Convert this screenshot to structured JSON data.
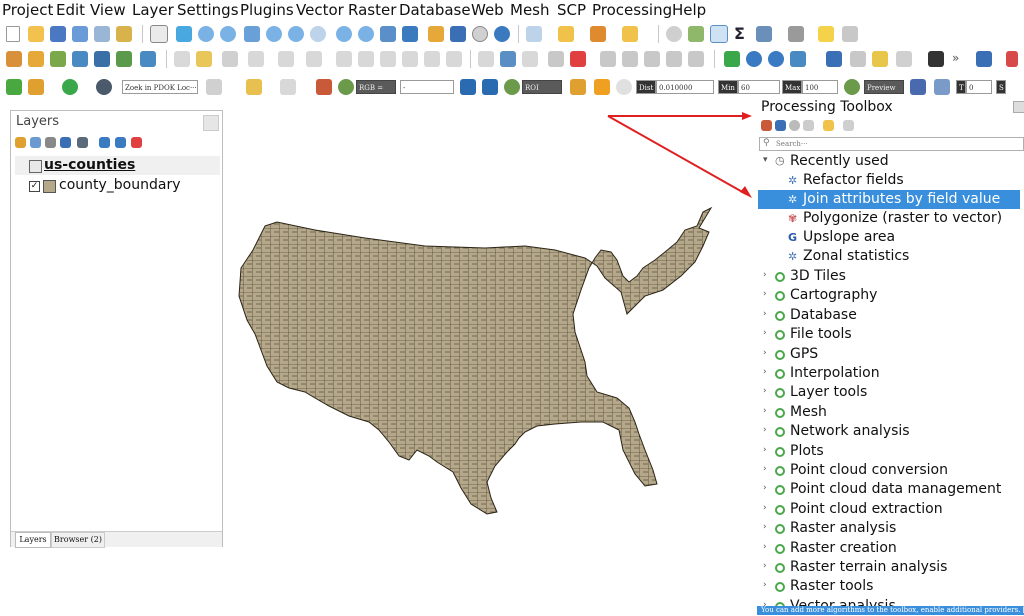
{
  "menu": [
    "Project",
    "Edit",
    "View",
    "Layer",
    "Settings",
    "Plugins",
    "Vector",
    "Raster",
    "Database",
    "Web",
    "Mesh",
    "SCP",
    "Processing",
    "Help"
  ],
  "toolbar3": {
    "locator_placeholder": "Zoek in PDOK Loc···",
    "rgb_label": "RGB =",
    "rgb_value": "-",
    "roi_label": "ROI",
    "preview_label": "Preview",
    "dist_label": "Dist",
    "dist_value": "0.010000",
    "min_label": "Min",
    "min_value": "60",
    "max_label": "Max",
    "max_value": "100",
    "t_label": "T",
    "t_value": "0",
    "s_label": "S"
  },
  "layers_panel": {
    "title": "Layers",
    "group_name": "us-counties",
    "layer_name": "county_boundary",
    "layer_checked": true,
    "tabs": [
      "Layers",
      "Browser (2)"
    ]
  },
  "toolbox": {
    "title": "Processing Toolbox",
    "search_placeholder": "Search···",
    "recently_used_label": "Recently used",
    "recent": [
      "Refactor fields",
      "Join attributes by field value",
      "Polygonize (raster to vector)",
      "Upslope area",
      "Zonal statistics"
    ],
    "selected_item": "Join attributes by field value",
    "providers": [
      "3D Tiles",
      "Cartography",
      "Database",
      "File tools",
      "GPS",
      "Interpolation",
      "Layer tools",
      "Mesh",
      "Network analysis",
      "Plots",
      "Point cloud conversion",
      "Point cloud data management",
      "Point cloud extraction",
      "Raster analysis",
      "Raster creation",
      "Raster terrain analysis",
      "Raster tools",
      "Vector analysis"
    ],
    "status_tip": "You can add more algorithms to the toolbox, enable additional providers. [close]"
  },
  "colors": {
    "county_fill": "#b5a88a",
    "selection": "#3a8fdc",
    "arrow": "#e02020",
    "tab_bg": "#f0f0f0"
  }
}
